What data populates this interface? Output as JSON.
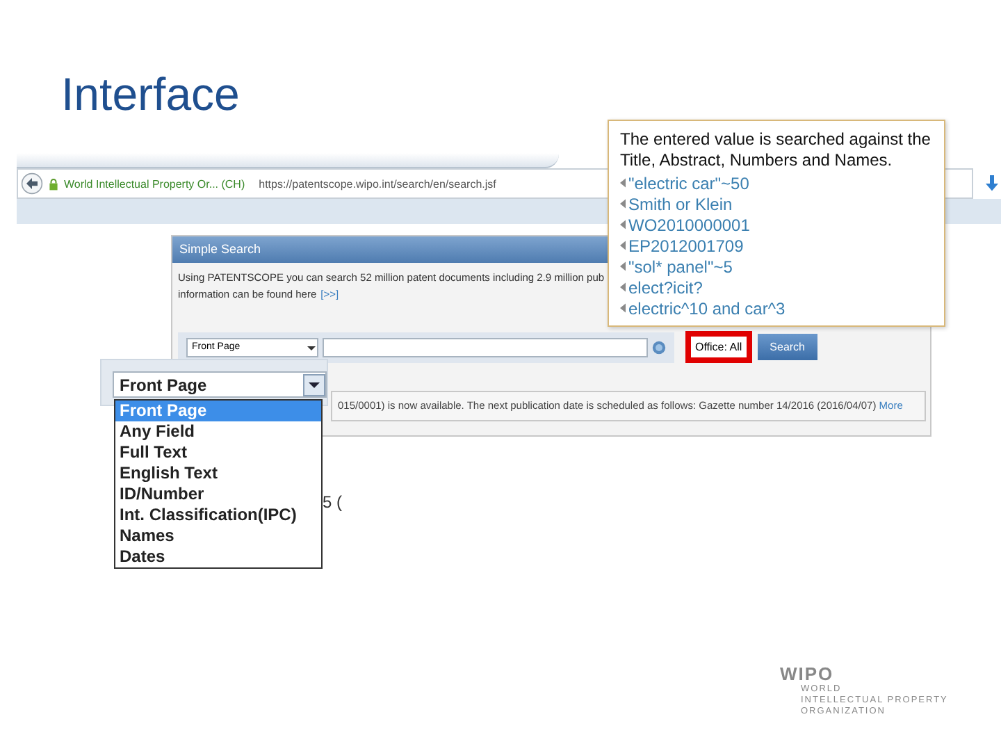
{
  "slide": {
    "title": "Interface"
  },
  "browser": {
    "site_name": "World Intellectual Property Or... (CH)",
    "url": "https://patentscope.wipo.int/search/en/search.jsf"
  },
  "panel": {
    "title": "Simple Search",
    "intro_line": "Using PATENTSCOPE you can search 52 million patent documents including 2.9 million pub",
    "intro_line_2": "information can be found here",
    "intro_link": "[>>]",
    "field_select": "Front Page",
    "office_button": {
      "label": "Office: All",
      "highlighted": true
    },
    "search_button": "Search",
    "notice": "015/0001) is now available. The next publication date is scheduled as follows: Gazette number 14/2016 (2016/04/07)",
    "notice_link": "More"
  },
  "tooltip": {
    "text": "The entered value is searched against the Title, Abstract, Numbers and Names.",
    "examples": [
      "\"electric car\"~50",
      "Smith or Klein",
      "WO2010000001",
      "EP2012001709",
      "\"sol* panel\"~5",
      "elect?icit?",
      "electric^10 and car^3"
    ]
  },
  "dropdown": {
    "value": "Front Page",
    "fragment": "5 (",
    "options": [
      {
        "label": "Front Page",
        "selected": true
      },
      {
        "label": "Any Field",
        "selected": false
      },
      {
        "label": "Full Text",
        "selected": false
      },
      {
        "label": "English Text",
        "selected": false
      },
      {
        "label": "ID/Number",
        "selected": false
      },
      {
        "label": "Int. Classification(IPC)",
        "selected": false
      },
      {
        "label": "Names",
        "selected": false
      },
      {
        "label": "Dates",
        "selected": false
      }
    ]
  },
  "logo": {
    "name": "WIPO",
    "lines": [
      "WORLD",
      "INTELLECTUAL PROPERTY",
      "ORGANIZATION"
    ]
  }
}
